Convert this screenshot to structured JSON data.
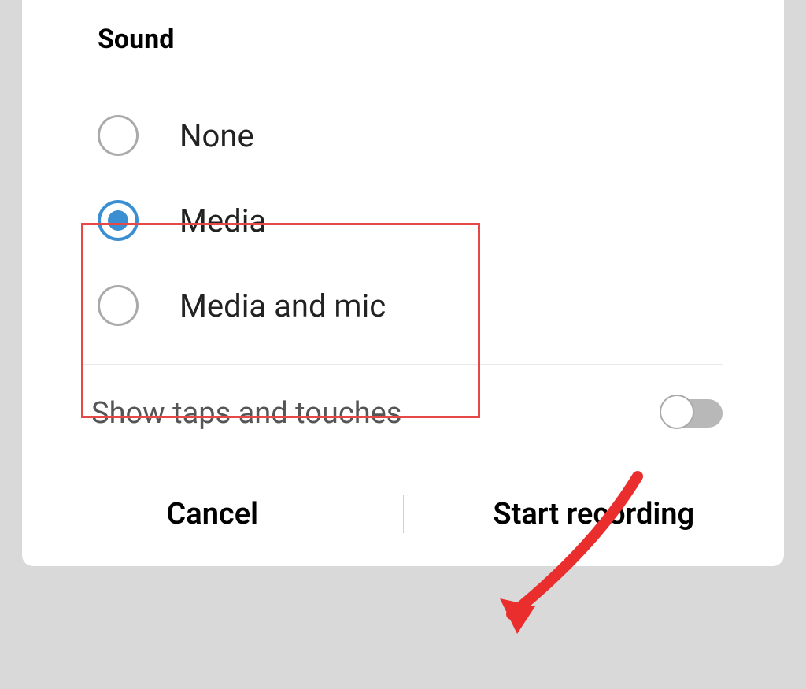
{
  "section": {
    "title": "Sound"
  },
  "options": {
    "none": "None",
    "media": "Media",
    "media_and_mic": "Media and mic",
    "selected": "media"
  },
  "toggle": {
    "label": "Show taps and touches",
    "state": "off"
  },
  "buttons": {
    "cancel": "Cancel",
    "start": "Start recording"
  },
  "annotations": {
    "highlight_color": "#e64747",
    "arrow_color": "#ea2e2e"
  }
}
